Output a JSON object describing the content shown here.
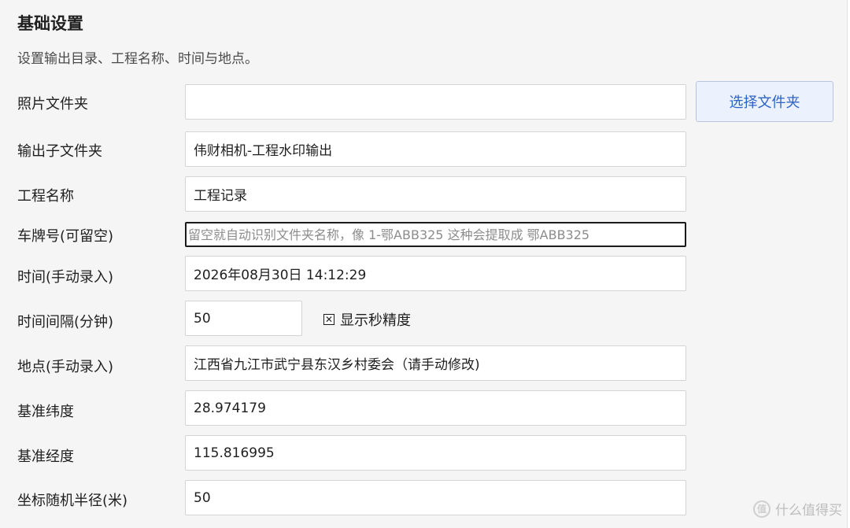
{
  "section": {
    "title": "基础设置",
    "description": "设置输出目录、工程名称、时间与地点。"
  },
  "fields": {
    "photo_folder": {
      "label": "照片文件夹",
      "value": "",
      "button_label": "选择文件夹"
    },
    "output_subfolder": {
      "label": "输出子文件夹",
      "value": "伟财相机-工程水印输出"
    },
    "project_name": {
      "label": "工程名称",
      "value": "工程记录"
    },
    "plate_number": {
      "label": "车牌号(可留空)",
      "value": "",
      "placeholder": "留空就自动识别文件夹名称，像 1-鄂ABB325 这种会提取成 鄂ABB325"
    },
    "time": {
      "label": "时间(手动录入)",
      "value": "2026年08月30日 14:12:29"
    },
    "interval": {
      "label": "时间间隔(分钟)",
      "value": "50",
      "checkbox_label": "显示秒精度",
      "checkbox_checked": true,
      "checkbox_mark": "✕"
    },
    "location": {
      "label": "地点(手动录入)",
      "value": "江西省九江市武宁县东汉乡村委会（请手动修改)"
    },
    "latitude": {
      "label": "基准纬度",
      "value": "28.974179"
    },
    "longitude": {
      "label": "基准经度",
      "value": "115.816995"
    },
    "radius": {
      "label": "坐标随机半径(米)",
      "value": "50"
    }
  },
  "watermark": {
    "text": "什么值得买",
    "icon": "zhi-logo-icon",
    "icon_glyph": "值"
  }
}
